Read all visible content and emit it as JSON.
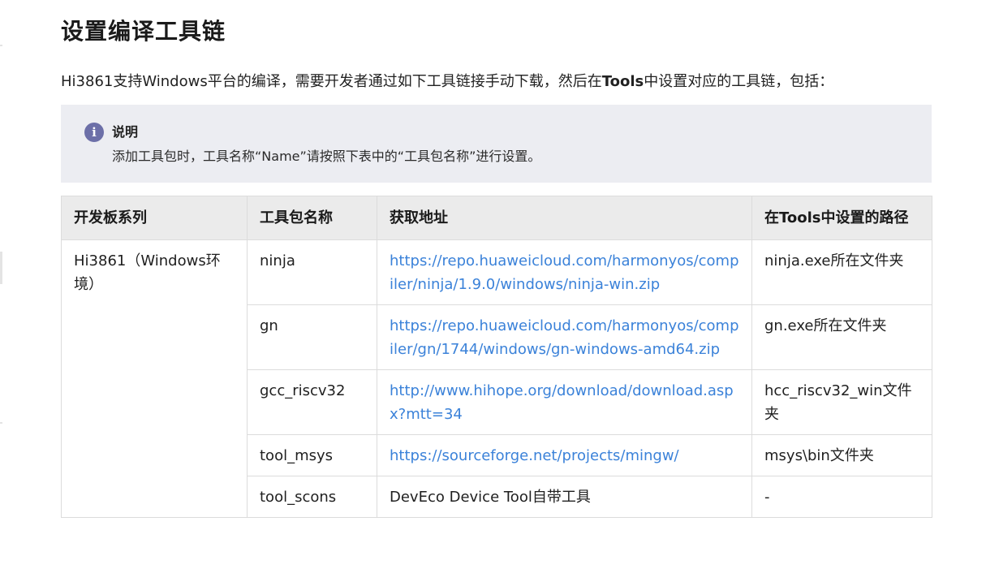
{
  "title": "设置编译工具链",
  "intro": {
    "before": "Hi3861支持Windows平台的编译，需要开发者通过如下工具链接手动下载，然后在",
    "bold": "Tools",
    "after": "中设置对应的工具链，包括："
  },
  "note": {
    "icon": "info-icon",
    "icon_glyph": "i",
    "title": "说明",
    "text": "添加工具包时，工具名称“Name”请按照下表中的“工具包名称”进行设置。"
  },
  "table": {
    "headers": [
      "开发板系列",
      "工具包名称",
      "获取地址",
      "在Tools中设置的路径"
    ],
    "board": "Hi3861（Windows环境）",
    "rows": [
      {
        "name": "ninja",
        "url": "https://repo.huaweicloud.com/harmonyos/compiler/ninja/1.9.0/windows/ninja-win.zip",
        "path": "ninja.exe所在文件夹"
      },
      {
        "name": "gn",
        "url": "https://repo.huaweicloud.com/harmonyos/compiler/gn/1744/windows/gn-windows-amd64.zip",
        "path": "gn.exe所在文件夹"
      },
      {
        "name": "gcc_riscv32",
        "url": "http://www.hihope.org/download/download.aspx?mtt=34",
        "path": "hcc_riscv32_win文件夹"
      },
      {
        "name": "tool_msys",
        "url": "https://sourceforge.net/projects/mingw/",
        "path": "msys\\bin文件夹"
      },
      {
        "name": "tool_scons",
        "source_text": "DevEco Device Tool自带工具",
        "path": "-"
      }
    ]
  },
  "colors": {
    "link": "#3b82d9",
    "note_bg": "#ecedf2",
    "header_bg": "#ebebeb",
    "icon_bg": "#6c6fa8"
  }
}
